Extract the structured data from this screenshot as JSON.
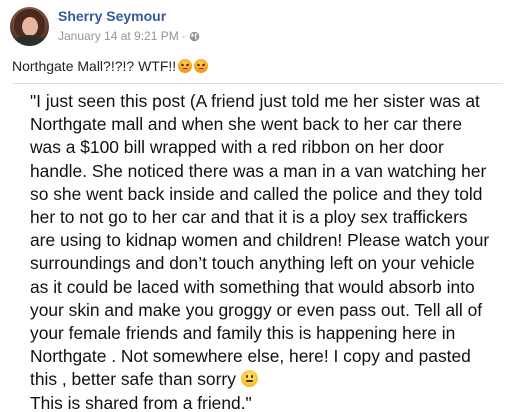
{
  "post": {
    "author": "Sherry Seymour",
    "timestamp": "January 14 at 9:21 PM",
    "separator": "·",
    "privacy_icon": "globe-icon",
    "status_text": "Northgate Mall?!?!? WTF!!",
    "status_emoji": [
      "angry-face-emoji",
      "angry-face-emoji"
    ]
  },
  "shared_image": {
    "lines": [
      "\"I just seen this post (A friend just told me her sister was at",
      "Northgate mall and when she went back to her car there",
      "was a $100 bill wrapped with a red ribbon on her door",
      "handle. She noticed there was a man in a van watching her",
      "so she went back inside and called the police and they told",
      "her to not go to her car and that it is a ploy sex traffickers",
      "are using to kidnap women and children! Please watch your",
      "surroundings and don’t touch anything left on your vehicle",
      "as it could be laced with something that would absorb into",
      "your skin and make you groggy or even pass out. Tell all of",
      "your female friends and family this is happening here in",
      "Northgate . Not somewhere else, here! I copy and pasted",
      "this , better safe than sorry ",
      "This is shared from a friend.\""
    ],
    "line_13_emoji": "confused-face-emoji"
  }
}
